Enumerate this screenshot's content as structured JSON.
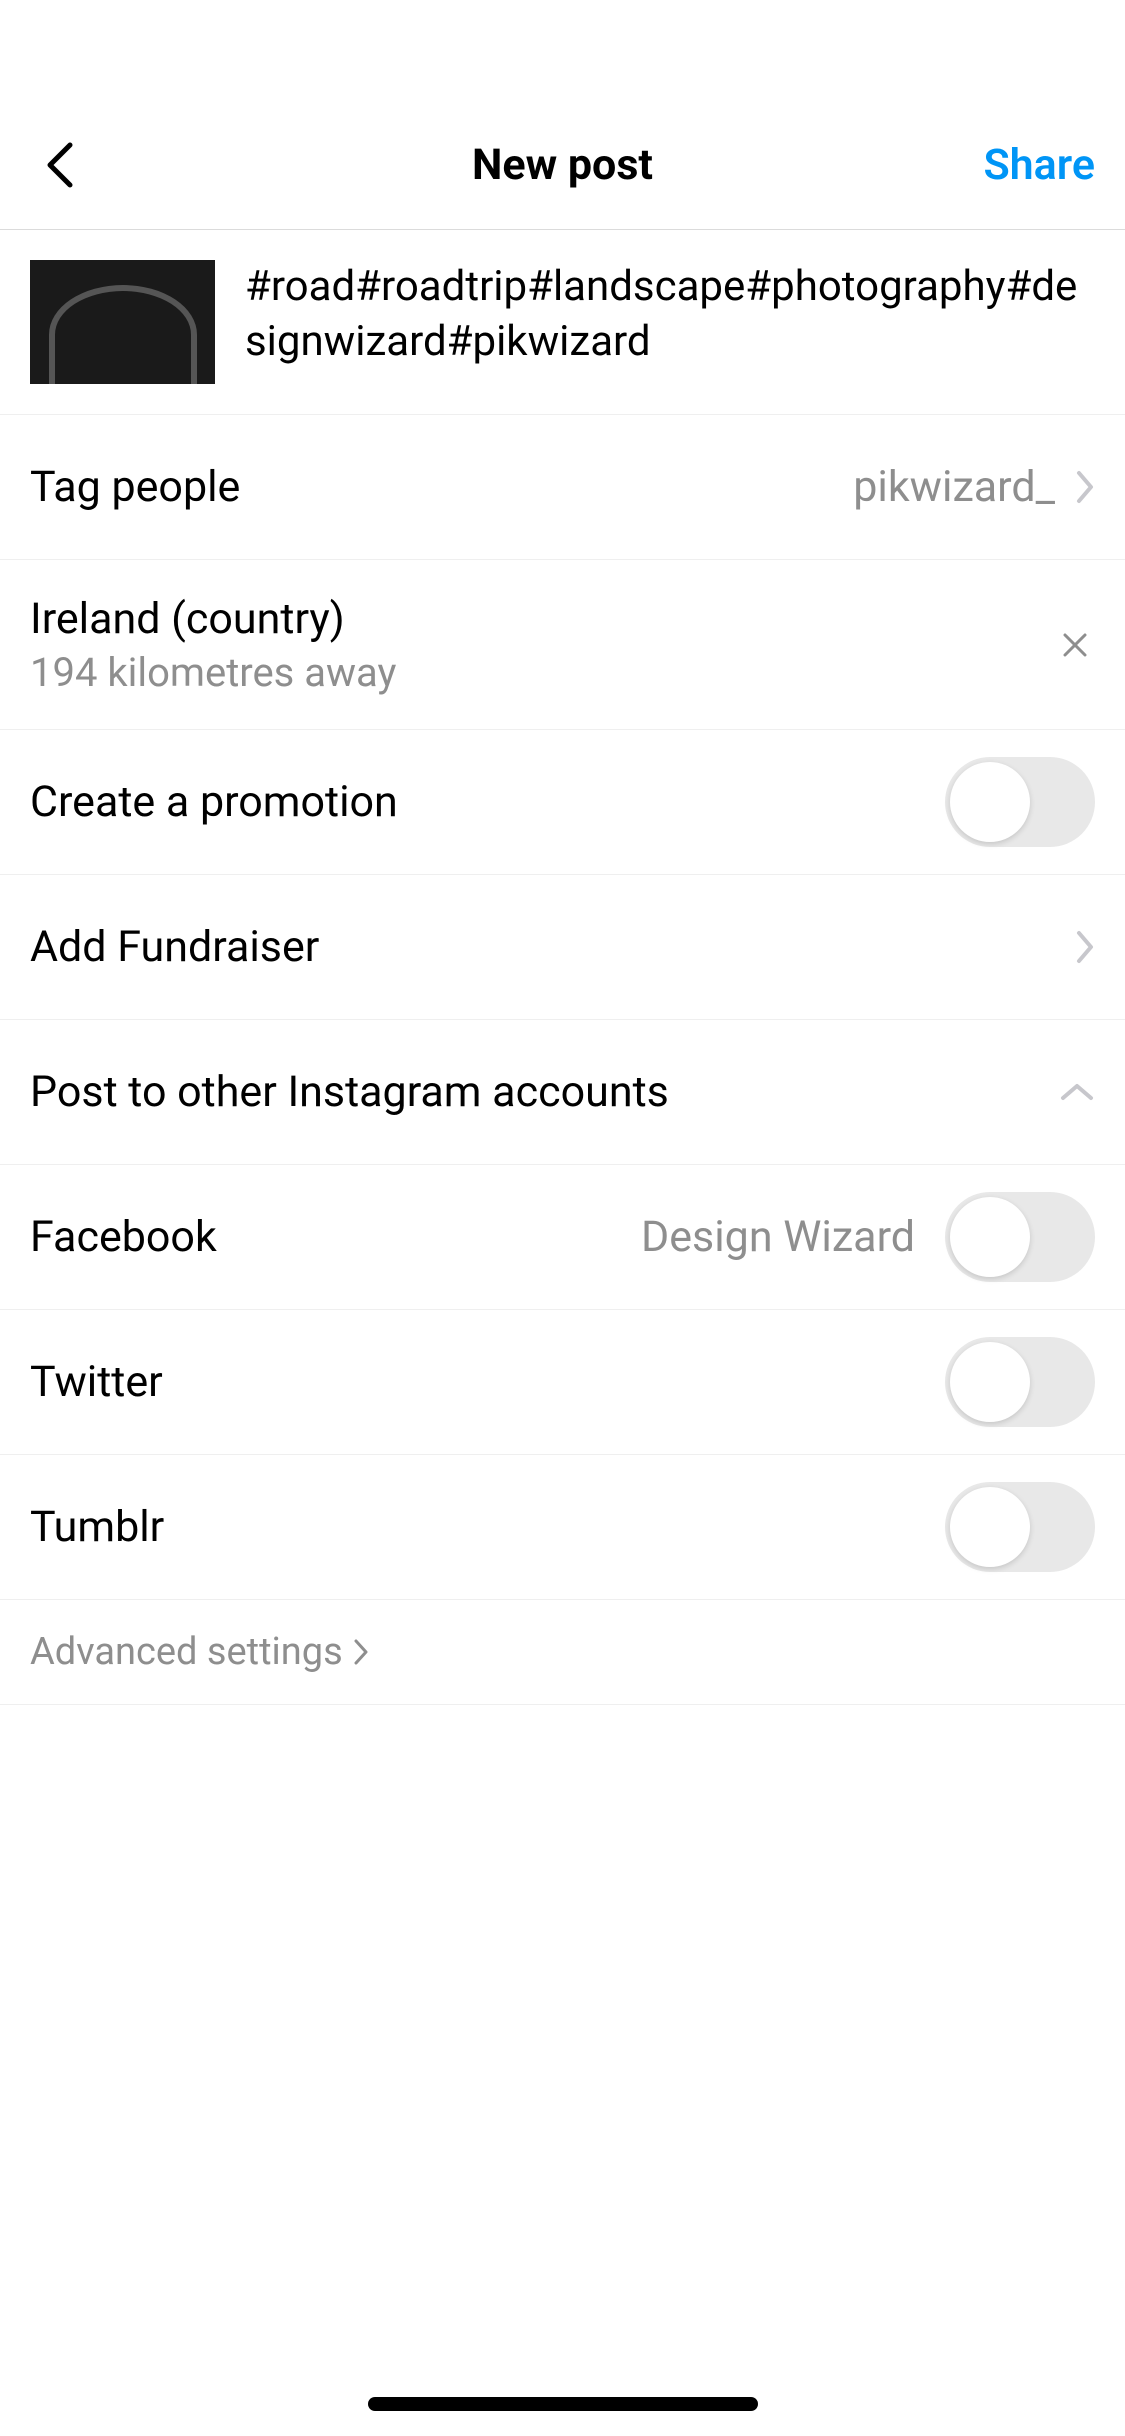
{
  "header": {
    "title": "New post",
    "share_label": "Share"
  },
  "caption": "#road#roadtrip#landscape#photography#designwizard#pikwizard",
  "rows": {
    "tag_people": {
      "label": "Tag people",
      "value": "pikwizard_"
    },
    "location": {
      "name": "Ireland (country)",
      "distance": "194 kilometres away"
    },
    "promotion": {
      "label": "Create a promotion"
    },
    "fundraiser": {
      "label": "Add Fundraiser"
    },
    "other_accounts": {
      "label": "Post to other Instagram accounts"
    },
    "facebook": {
      "label": "Facebook",
      "account": "Design Wizard"
    },
    "twitter": {
      "label": "Twitter"
    },
    "tumblr": {
      "label": "Tumblr"
    }
  },
  "advanced": {
    "label": "Advanced settings"
  }
}
